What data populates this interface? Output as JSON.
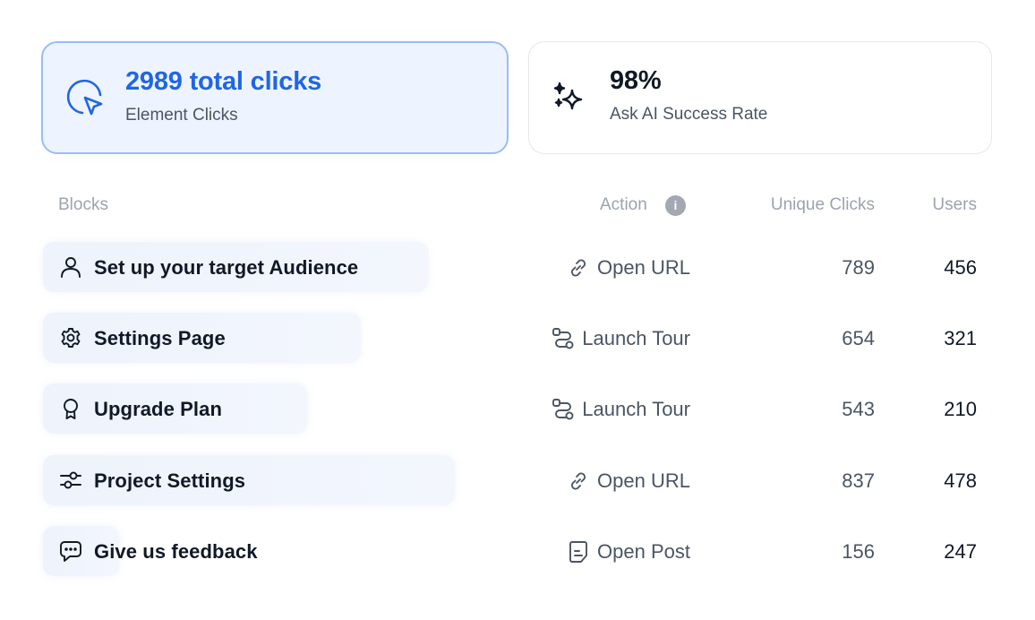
{
  "cards": [
    {
      "value": "2989 total clicks",
      "label": "Element Clicks",
      "icon": "cursor-click-icon"
    },
    {
      "value": "98%",
      "label": "Ask AI Success Rate",
      "icon": "sparkle-icon"
    }
  ],
  "table": {
    "headers": {
      "blocks": "Blocks",
      "action": "Action",
      "unique_clicks": "Unique Clicks",
      "users": "Users"
    },
    "info_icon": "i",
    "rows": [
      {
        "block": "Set up your target Audience",
        "block_icon": "user-icon",
        "action": "Open URL",
        "action_icon": "link-icon",
        "unique_clicks": "789",
        "users": "456",
        "bar_fraction": 0.86
      },
      {
        "block": "Settings Page",
        "block_icon": "gear-icon",
        "action": "Launch Tour",
        "action_icon": "route-icon",
        "unique_clicks": "654",
        "users": "321",
        "bar_fraction": 0.71
      },
      {
        "block": "Upgrade Plan",
        "block_icon": "award-icon",
        "action": "Launch Tour",
        "action_icon": "route-icon",
        "unique_clicks": "543",
        "users": "210",
        "bar_fraction": 0.59
      },
      {
        "block": "Project Settings",
        "block_icon": "sliders-icon",
        "action": "Open URL",
        "action_icon": "link-icon",
        "unique_clicks": "837",
        "users": "478",
        "bar_fraction": 0.92
      },
      {
        "block": "Give us feedback",
        "block_icon": "message-icon",
        "action": "Open Post",
        "action_icon": "document-icon",
        "unique_clicks": "156",
        "users": "247",
        "bar_fraction": 0.17
      }
    ]
  }
}
